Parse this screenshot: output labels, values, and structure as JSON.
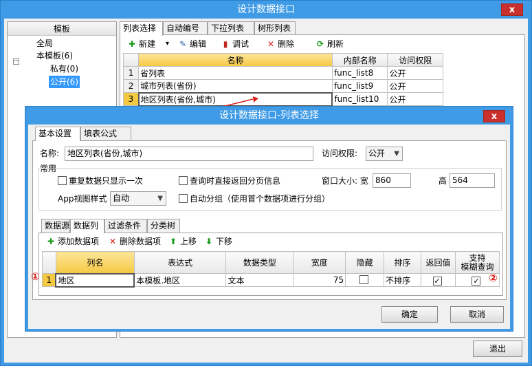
{
  "outer": {
    "title": "设计数据接口",
    "close": "x",
    "tree": {
      "header": "模板",
      "items": [
        "全局",
        "本模板(6)",
        "私有(0)",
        "公开(6)"
      ],
      "expander": "−"
    },
    "tabs": [
      "列表选择",
      "自动编号",
      "下拉列表",
      "树形列表"
    ],
    "toolbar": {
      "new": "新建",
      "new_dropdown": "▾",
      "edit": "编辑",
      "debug": "调试",
      "delete": "删除",
      "refresh": "刷新"
    },
    "grid": {
      "headers": [
        "名称",
        "内部名称",
        "访问权限"
      ],
      "rows": [
        {
          "num": "1",
          "name": "省列表",
          "internal": "func_list8",
          "access": "公开"
        },
        {
          "num": "2",
          "name": "城市列表(省份)",
          "internal": "func_list9",
          "access": "公开"
        },
        {
          "num": "3",
          "name": "地区列表(省份,城市)",
          "internal": "func_list10",
          "access": "公开"
        }
      ]
    },
    "exit_button": "退出"
  },
  "inner": {
    "title": "设计数据接口-列表选择",
    "close": "x",
    "tabs": [
      "基本设置",
      "填表公式"
    ],
    "name_label": "名称:",
    "name_value": "地区列表(省份,城市)",
    "access_label": "访问权限:",
    "access_value": "公开",
    "group_label": "常用",
    "options": {
      "repeat_once": "重复数据只显示一次",
      "paging_info": "查询时直接返回分页信息",
      "auto_group": "自动分组（使用首个数据项进行分组）"
    },
    "window_size_label": "窗口大小: 宽",
    "width_value": "860",
    "height_label": "高",
    "height_value": "564",
    "app_view_label": "App视图样式",
    "app_view_value": "自动",
    "sub_tabs": [
      "数据源",
      "数据列",
      "过滤条件",
      "分类树"
    ],
    "col_toolbar": {
      "add": "添加数据项",
      "delete": "删除数据项",
      "up": "上移",
      "down": "下移"
    },
    "col_grid": {
      "headers": [
        "列名",
        "表达式",
        "数据类型",
        "宽度",
        "隐藏",
        "排序",
        "返回值",
        "支持",
        "模糊查询"
      ],
      "row": {
        "num": "1",
        "col_name": "地区",
        "expression": "本模板.地区",
        "data_type": "文本",
        "width": "75",
        "sort": "不排序"
      }
    },
    "marker1": "①",
    "marker2": "②",
    "ok": "确定",
    "cancel": "取消"
  },
  "colors": {
    "title_bar": "#3f9be6",
    "close": "#c9302c",
    "header_highlight": "#f5c842",
    "selection": "#3399ff"
  }
}
